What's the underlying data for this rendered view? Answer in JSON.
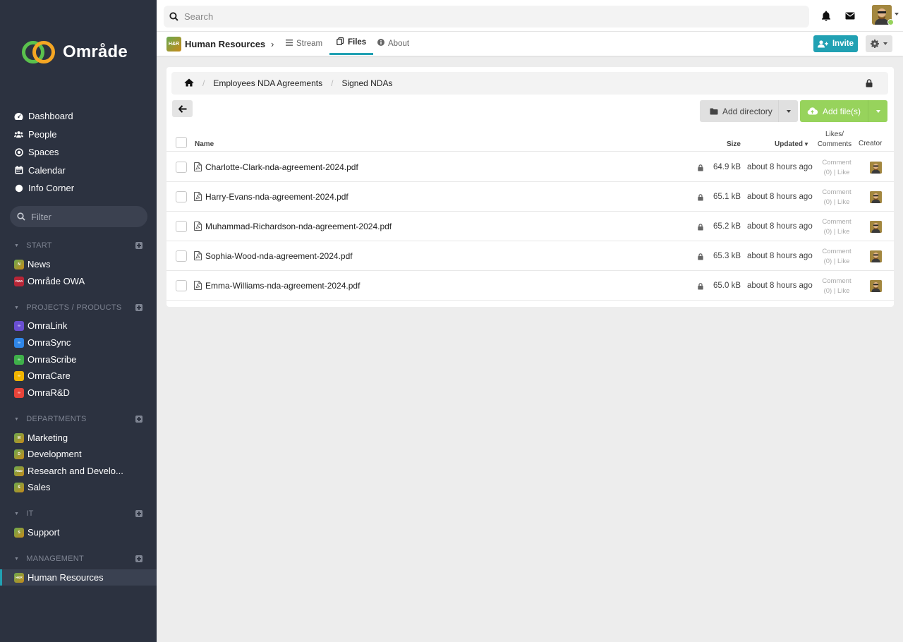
{
  "brand": {
    "name": "Område"
  },
  "main_nav": [
    {
      "label": "Dashboard",
      "icon": "dashboard-icon"
    },
    {
      "label": "People",
      "icon": "people-icon"
    },
    {
      "label": "Spaces",
      "icon": "spaces-icon"
    },
    {
      "label": "Calendar",
      "icon": "calendar-icon"
    },
    {
      "label": "Info Corner",
      "icon": "info-corner-icon"
    }
  ],
  "filter": {
    "placeholder": "Filter"
  },
  "groups": {
    "start": {
      "label": "START",
      "items": [
        {
          "label": "News",
          "badge": "N",
          "color": "#6aa84f"
        },
        {
          "label": "Område OWA",
          "badge": "OWA",
          "color": "#c0392b"
        }
      ]
    },
    "projects": {
      "label": "PROJECTS / PRODUCTS",
      "items": [
        {
          "label": "OmraLink",
          "color": "#6a4fd1"
        },
        {
          "label": "OmraSync",
          "color": "#2f86e8"
        },
        {
          "label": "OmraScribe",
          "color": "#3fb04a"
        },
        {
          "label": "OmraCare",
          "color": "#f0b400"
        },
        {
          "label": "OmraR&D",
          "color": "#e8443a"
        }
      ]
    },
    "departments": {
      "label": "DEPARTMENTS",
      "items": [
        {
          "label": "Marketing",
          "badge": "M"
        },
        {
          "label": "Development",
          "badge": "D"
        },
        {
          "label": "Research and Develo...",
          "badge": "R&D"
        },
        {
          "label": "Sales",
          "badge": "S"
        }
      ]
    },
    "it": {
      "label": "IT",
      "items": [
        {
          "label": "Support",
          "badge": "S"
        }
      ]
    },
    "management": {
      "label": "MANAGEMENT",
      "items": [
        {
          "label": "Human Resources",
          "badge": "H&R"
        }
      ]
    }
  },
  "search": {
    "placeholder": "Search"
  },
  "space": {
    "badge": "H&R",
    "title": "Human Resources",
    "tabs": [
      {
        "label": "Stream"
      },
      {
        "label": "Files"
      },
      {
        "label": "About"
      }
    ],
    "invite_label": "Invite"
  },
  "breadcrumb": [
    "Employees NDA Agreements",
    "Signed NDAs"
  ],
  "toolbar": {
    "add_directory": "Add directory",
    "add_files": "Add file(s)"
  },
  "table": {
    "headers": {
      "name": "Name",
      "size": "Size",
      "updated": "Updated",
      "likes_line1": "Likes/",
      "likes_line2": "Comments",
      "creator": "Creator"
    },
    "rows": [
      {
        "name": "Charlotte-Clark-nda-agreement-2024.pdf",
        "size": "64.9 kB",
        "updated": "about 8 hours ago",
        "comment": "Comment",
        "count": "(0)",
        "like": "Like"
      },
      {
        "name": "Harry-Evans-nda-agreement-2024.pdf",
        "size": "65.1 kB",
        "updated": "about 8 hours ago",
        "comment": "Comment",
        "count": "(0)",
        "like": "Like"
      },
      {
        "name": "Muhammad-Richardson-nda-agreement-2024.pdf",
        "size": "65.2 kB",
        "updated": "about 8 hours ago",
        "comment": "Comment",
        "count": "(0)",
        "like": "Like"
      },
      {
        "name": "Sophia-Wood-nda-agreement-2024.pdf",
        "size": "65.3 kB",
        "updated": "about 8 hours ago",
        "comment": "Comment",
        "count": "(0)",
        "like": "Like"
      },
      {
        "name": "Emma-Williams-nda-agreement-2024.pdf",
        "size": "65.0 kB",
        "updated": "about 8 hours ago",
        "comment": "Comment",
        "count": "(0)",
        "like": "Like"
      }
    ]
  },
  "colors": {
    "accent": "#21a1b3",
    "success": "#97d35c",
    "sidebar_bg": "#2c3240"
  }
}
